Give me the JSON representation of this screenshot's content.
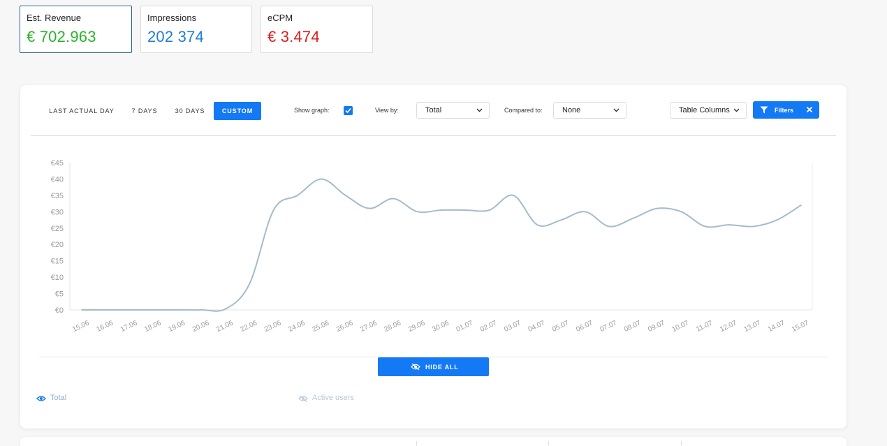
{
  "kpis": [
    {
      "label": "Est. Revenue",
      "value": "€ 702.963",
      "color": "#29b329"
    },
    {
      "label": "Impressions",
      "value": "202 374",
      "color": "#1f7fd6"
    },
    {
      "label": "eCPM",
      "value": "€ 3.474",
      "color": "#d92020"
    }
  ],
  "toolbar": {
    "ranges": [
      "LAST ACTUAL DAY",
      "7 DAYS",
      "30 DAYS",
      "CUSTOM"
    ],
    "show_graph_label": "Show graph:",
    "show_graph_checked": true,
    "view_by_label": "View by:",
    "view_by_value": "Total",
    "compared_to_label": "Compared to:",
    "compared_to_value": "None",
    "table_columns_label": "Table Columns",
    "filters_label": "Filters"
  },
  "hide_all_label": "HIDE ALL",
  "legend": [
    {
      "label": "Total",
      "visible": true
    },
    {
      "label": "Active users",
      "visible": false
    }
  ],
  "colors": {
    "accent": "#1479f4",
    "line": "#a3bccb",
    "legend_text": "#8fb0cc"
  },
  "chart_data": {
    "type": "line",
    "title": "",
    "xlabel": "",
    "ylabel": "",
    "ylim": [
      0,
      45
    ],
    "y_ticks": [
      "€0",
      "€5",
      "€10",
      "€15",
      "€20",
      "€25",
      "€30",
      "€35",
      "€40",
      "€45"
    ],
    "categories": [
      "15.06",
      "16.06",
      "17.06",
      "18.06",
      "19.06",
      "20.06",
      "21.06",
      "22.06",
      "23.06",
      "24.06",
      "25.06",
      "26.06",
      "27.06",
      "28.06",
      "29.06",
      "30.06",
      "01.07",
      "02.07",
      "03.07",
      "04.07",
      "05.07",
      "06.07",
      "07.07",
      "08.07",
      "09.07",
      "10.07",
      "11.07",
      "12.07",
      "13.07",
      "14.07",
      "15.07"
    ],
    "series": [
      {
        "name": "Total",
        "values": [
          0,
          0,
          0,
          0,
          0,
          0,
          0.3,
          8,
          30.5,
          35,
          40,
          35,
          31,
          34,
          30,
          30.5,
          30.5,
          30.5,
          35,
          26,
          27.5,
          30,
          25.5,
          28,
          31,
          30,
          25.5,
          26,
          25.5,
          27.5,
          32
        ]
      }
    ],
    "grid": false,
    "legend": "bottom-left"
  }
}
